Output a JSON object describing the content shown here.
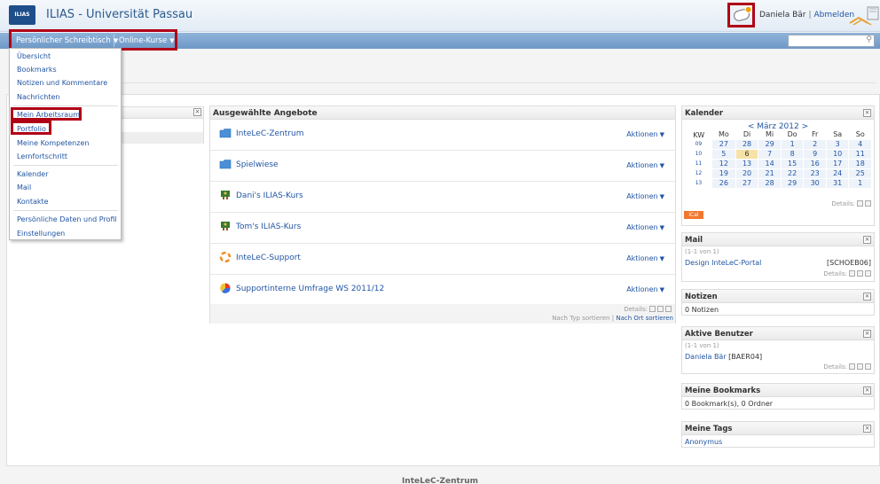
{
  "header": {
    "logo_text": "ILIAS",
    "app_title": "ILIAS - Universität Passau",
    "user_name": "Daniela Bär",
    "separator": "|",
    "logout_label": "Abmelden"
  },
  "menu": {
    "desk_label": "Persönlicher Schreibtisch",
    "courses_label": "Online-Kurse",
    "caret": "▼",
    "search_placeholder": ""
  },
  "dropdown": {
    "items": [
      "Übersicht",
      "Bookmarks",
      "Notizen und Kommentare",
      "Nachrichten",
      "Mein Arbeitsraum",
      "Portfolio",
      "Meine Kompetenzen",
      "Lernfortschritt",
      "Kalender",
      "Mail",
      "Kontakte",
      "Persönliche Daten und Profil",
      "Einstellungen"
    ]
  },
  "center": {
    "title": "Ausgewählte Angebote",
    "actions_label": "Aktionen",
    "items": [
      {
        "label": "InteLeC-Zentrum",
        "icon": "folder-icon"
      },
      {
        "label": "Spielwiese",
        "icon": "folder-icon"
      },
      {
        "label": "Dani's ILIAS-Kurs",
        "icon": "course-icon"
      },
      {
        "label": "Tom's ILIAS-Kurs",
        "icon": "course-icon"
      },
      {
        "label": "InteLeC-Support",
        "icon": "support-icon"
      },
      {
        "label": "Supportinterne Umfrage WS 2011/12",
        "icon": "survey-icon"
      }
    ],
    "details_label": "Details:",
    "sort_by_type": "Nach Typ sortieren",
    "sort_sep": "|",
    "sort_by_location": "Nach Ort sortieren"
  },
  "calendar": {
    "title": "Kalender",
    "nav": "< März 2012 >",
    "columns": [
      "KW",
      "Mo",
      "Di",
      "Mi",
      "Do",
      "Fr",
      "Sa",
      "So"
    ],
    "weeks": [
      [
        "09",
        "27",
        "28",
        "29",
        "1",
        "2",
        "3",
        "4"
      ],
      [
        "10",
        "5",
        "6",
        "7",
        "8",
        "9",
        "10",
        "11"
      ],
      [
        "11",
        "12",
        "13",
        "14",
        "15",
        "16",
        "17",
        "18"
      ],
      [
        "12",
        "19",
        "20",
        "21",
        "22",
        "23",
        "24",
        "25"
      ],
      [
        "13",
        "26",
        "27",
        "28",
        "29",
        "30",
        "31",
        "1"
      ]
    ],
    "today": "6",
    "details_label": "Details:",
    "ical_label": "iCal"
  },
  "mail": {
    "title": "Mail",
    "count": "(1-1 von 1)",
    "subject": "Design InteLeC-Portal",
    "sender": "[SCHOEB06]",
    "details_label": "Details:"
  },
  "notes": {
    "title": "Notizen",
    "text": "0 Notizen"
  },
  "active_users": {
    "title": "Aktive Benutzer",
    "count": "(1-1 von 1)",
    "user": "Daniela Bär",
    "user_id": "[BAER04]",
    "details_label": "Details:"
  },
  "bookmarks": {
    "title": "Meine Bookmarks",
    "text": "0 Bookmark(s), 0 Ordner"
  },
  "tags": {
    "title": "Meine Tags",
    "tag": "Anonymus"
  },
  "close_glyph": "×",
  "footer": {
    "text": "InteLeC-Zentrum"
  }
}
